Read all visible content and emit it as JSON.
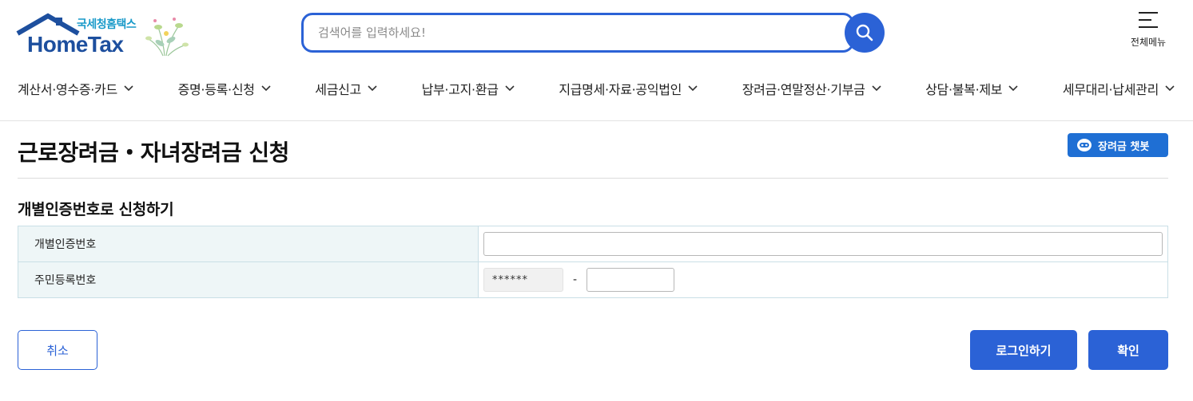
{
  "header": {
    "logo_sub": "국세청홈택스",
    "logo_main": "HomeTax",
    "search_placeholder": "검색어를 입력하세요!",
    "all_menu_label": "전체메뉴"
  },
  "gnb": [
    "계산서·영수증·카드",
    "증명·등록·신청",
    "세금신고",
    "납부·고지·환급",
    "지급명세·자료·공익법인",
    "장려금·연말정산·기부금",
    "상담·불복·제보",
    "세무대리·납세관리"
  ],
  "page": {
    "title": "근로장려금・자녀장려금 신청",
    "chatbot_label": "장려금 챗봇",
    "section_title": "개별인증번호로 신청하기"
  },
  "form": {
    "auth_label": "개별인증번호",
    "auth_value": "",
    "rrn_label": "주민등록번호",
    "rrn_front": "******",
    "rrn_dash": "-",
    "rrn_back": ""
  },
  "buttons": {
    "cancel": "취소",
    "login": "로그인하기",
    "confirm": "확인"
  },
  "colors": {
    "primary": "#2b62d6",
    "chatbot": "#1f6fd4",
    "table_header_bg": "#eef6f7",
    "logo_blue": "#1d4f9e",
    "logo_sub": "#1a9ac9"
  }
}
